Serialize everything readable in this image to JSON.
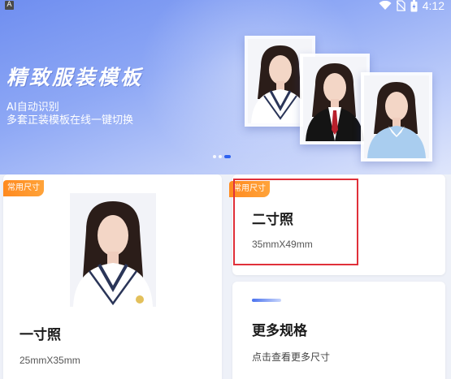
{
  "status_bar": {
    "app_icon_letter": "A",
    "time": "4:12"
  },
  "banner": {
    "title": "精致服装模板",
    "subtitle_line1": "AI自动识别",
    "subtitle_line2": "多套正装模板在线一键切换",
    "carousel_pages": 3,
    "active_page": 3
  },
  "cards": {
    "one_inch": {
      "tag": "常用尺寸",
      "title": "一寸照",
      "size": "25mmX35mm"
    },
    "two_inch": {
      "tag": "常用尺寸",
      "title": "二寸照",
      "size": "35mmX49mm"
    },
    "more": {
      "title": "更多规格",
      "subtitle": "点击查看更多尺寸"
    }
  },
  "colors": {
    "tag": "#ff8a1f",
    "accent": "#2e62f0",
    "highlight": "#e0303a"
  },
  "icons": {
    "wifi": "wifi-icon",
    "no_sim": "no-sim-icon",
    "battery": "battery-charging-icon"
  }
}
